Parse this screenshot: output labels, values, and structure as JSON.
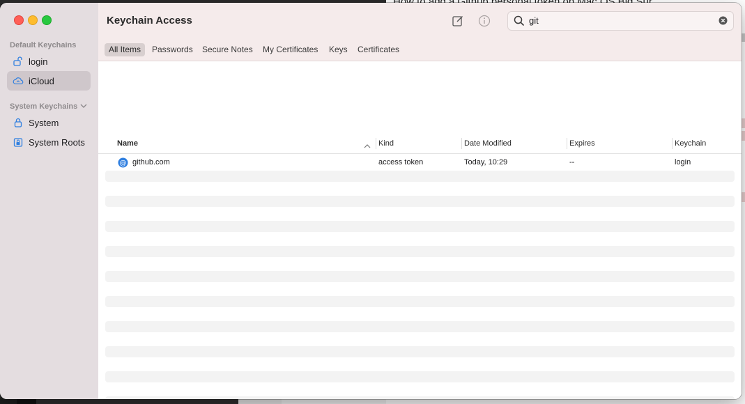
{
  "background": {
    "header_text": "How to add a Github personal token on Mac OS Big Sur"
  },
  "sidebar": {
    "default_section": "Default Keychains",
    "system_section": "System Keychains",
    "items": [
      {
        "label": "login",
        "icon": "lock-open-icon"
      },
      {
        "label": "iCloud",
        "icon": "cloud-icon",
        "selected": true
      },
      {
        "label": "System",
        "icon": "lock-icon"
      },
      {
        "label": "System Roots",
        "icon": "lock-cabinet-icon"
      }
    ]
  },
  "toolbar": {
    "title": "Keychain Access",
    "search_value": "git"
  },
  "tabs": [
    "All Items",
    "Passwords",
    "Secure Notes",
    "My Certificates",
    "Keys",
    "Certificates"
  ],
  "table": {
    "columns": [
      "Name",
      "Kind",
      "Date Modified",
      "Expires",
      "Keychain"
    ],
    "rows": [
      {
        "name": "github.com",
        "kind": "access token",
        "date_modified": "Today, 10:29",
        "expires": "--",
        "keychain": "login"
      }
    ]
  },
  "colors": {
    "sidebar_bg": "#e4dde0",
    "toolbar_bg": "#f5ebeb",
    "row_icon": "#2f7fe0"
  }
}
